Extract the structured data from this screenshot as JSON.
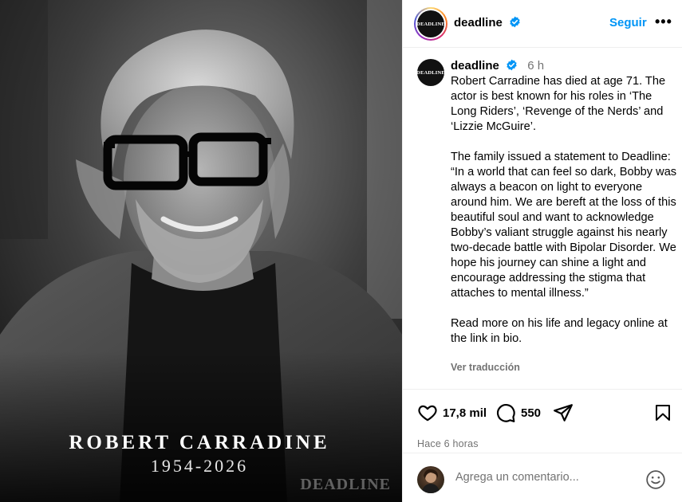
{
  "photo": {
    "name": "ROBERT CARRADINE",
    "years": "1954-2026",
    "watermark": "DEADLINE"
  },
  "header": {
    "logo_text": "DEADLINE",
    "username": "deadline",
    "follow_label": "Seguir",
    "more_label": "•••"
  },
  "caption": {
    "logo_text": "DEADLINE",
    "username": "deadline",
    "time": "6 h",
    "paragraphs": [
      "Robert Carradine has died at age 71. The actor is best known for his roles in ‘The Long Riders’, ‘Revenge of the Nerds’ and ‘Lizzie McGuire’.",
      "The family issued a statement to Deadline: “In a world that can feel so dark, Bobby was always a beacon on light to everyone around him. We are bereft at the loss of this beautiful soul and want to acknowledge Bobby’s valiant struggle against his nearly two-decade battle with Bipolar Disorder. We hope his journey can shine a light and encourage addressing the stigma that attaches to mental illness.”",
      "Read more on his life and legacy online at the link in bio."
    ],
    "translate_label": "Ver traducción"
  },
  "actions": {
    "likes": "17,8 mil",
    "comments": "550"
  },
  "posted": "Hace 6 horas",
  "comment": {
    "placeholder": "Agrega un comentario..."
  },
  "colors": {
    "accent": "#0095f6",
    "muted": "#737373",
    "divider": "#efefef"
  }
}
